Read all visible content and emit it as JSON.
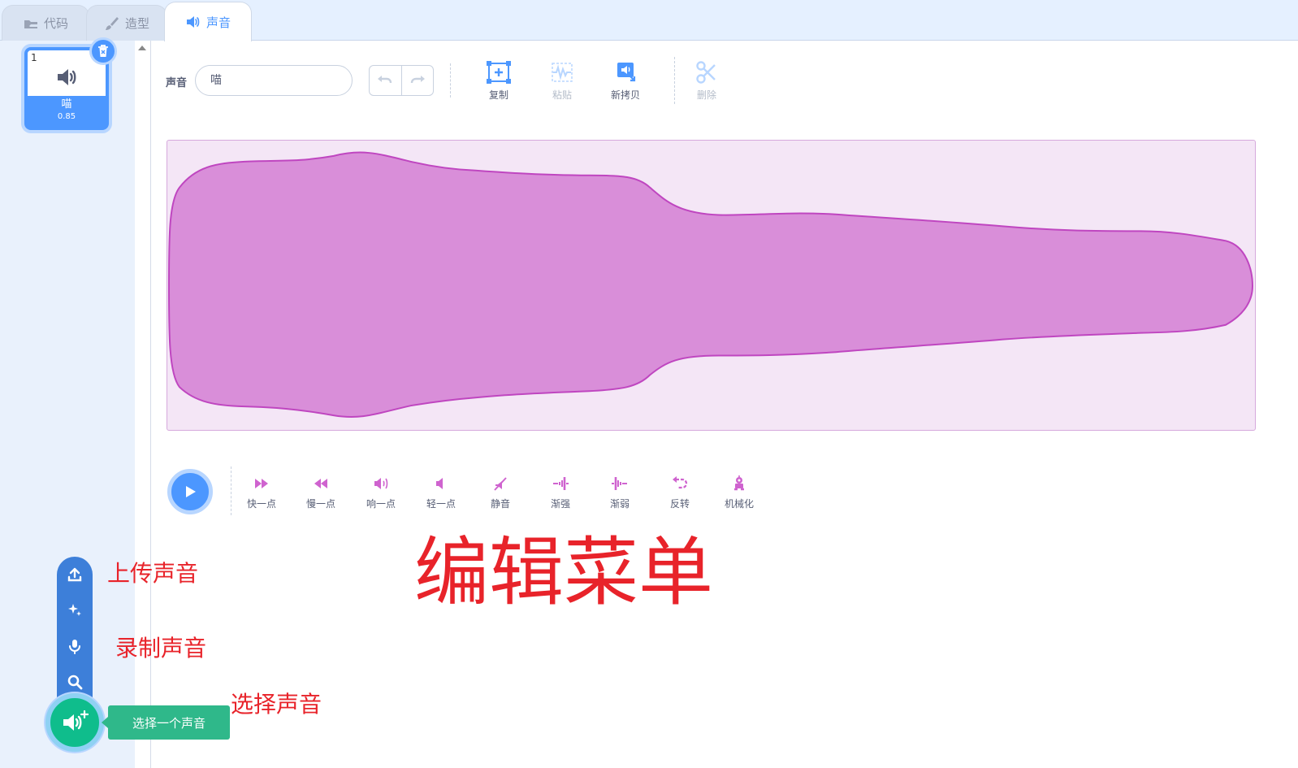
{
  "tabs": [
    {
      "label": "代码",
      "icon": "code-icon"
    },
    {
      "label": "造型",
      "icon": "brush-icon"
    },
    {
      "label": "声音",
      "icon": "speaker-icon",
      "active": true
    }
  ],
  "sound_list": {
    "items": [
      {
        "index": "1",
        "name": "喵",
        "duration": "0.85",
        "selected": true
      }
    ]
  },
  "editor": {
    "name_label": "声音",
    "name_value": "喵",
    "tools": [
      {
        "label": "复制",
        "icon": "copy-icon",
        "enabled": true
      },
      {
        "label": "粘贴",
        "icon": "paste-icon",
        "enabled": false
      },
      {
        "label": "新拷贝",
        "icon": "copy-to-new-icon",
        "enabled": true
      },
      {
        "label": "删除",
        "icon": "scissors-icon",
        "enabled": false
      }
    ]
  },
  "effects": [
    {
      "label": "快一点",
      "icon": "faster-icon"
    },
    {
      "label": "慢一点",
      "icon": "slower-icon"
    },
    {
      "label": "响一点",
      "icon": "louder-icon"
    },
    {
      "label": "轻一点",
      "icon": "softer-icon"
    },
    {
      "label": "静音",
      "icon": "mute-icon"
    },
    {
      "label": "渐强",
      "icon": "fade-in-icon"
    },
    {
      "label": "渐弱",
      "icon": "fade-out-icon"
    },
    {
      "label": "反转",
      "icon": "reverse-icon"
    },
    {
      "label": "机械化",
      "icon": "robot-icon"
    }
  ],
  "annotations": {
    "edit_menu": "编辑菜单",
    "upload": "上传声音",
    "record": "录制声音",
    "choose": "选择声音"
  },
  "add_menu": {
    "tooltip": "选择一个声音",
    "items": [
      "upload-icon",
      "surprise-icon",
      "microphone-icon",
      "search-icon"
    ]
  },
  "colors": {
    "accent": "#4c97ff",
    "wave_fill": "#d98ed9",
    "wave_stroke": "#bf46c0",
    "wave_bg": "#f4e6f6",
    "effect_color": "#cf63cf",
    "add_button": "#0fbd8c",
    "annotation": "#e8232a"
  }
}
